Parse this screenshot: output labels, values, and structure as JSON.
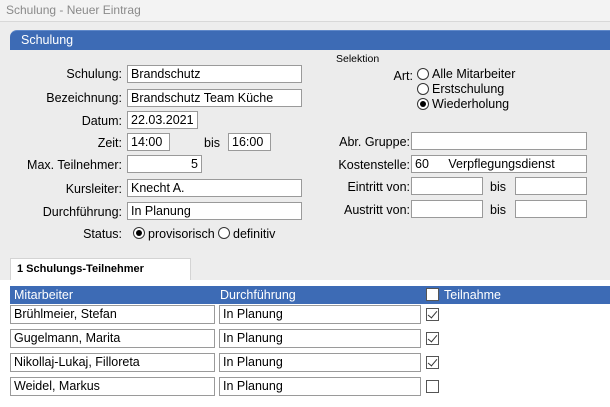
{
  "window": {
    "title": "Schulung - Neuer Eintrag"
  },
  "section": {
    "title": "Schulung"
  },
  "form": {
    "schulung_label": "Schulung:",
    "schulung_value": "Brandschutz",
    "bezeichnung_label": "Bezeichnung:",
    "bezeichnung_value": "Brandschutz Team Küche",
    "datum_label": "Datum:",
    "datum_value": "22.03.2021",
    "zeit_label": "Zeit:",
    "zeit_from": "14:00",
    "bis_label": "bis",
    "zeit_to": "16:00",
    "max_label": "Max. Teilnehmer:",
    "max_value": "5",
    "kursleiter_label": "Kursleiter:",
    "kursleiter_value": "Knecht A.",
    "durchfuehrung_label": "Durchführung:",
    "durchfuehrung_value": "In Planung",
    "status_label": "Status:",
    "status_options": [
      "provisorisch",
      "definitiv"
    ],
    "status_selected": "provisorisch"
  },
  "selektion": {
    "title": "Selektion",
    "art_label": "Art:",
    "art_options": [
      "Alle Mitarbeiter",
      "Erstschulung",
      "Wiederholung"
    ],
    "art_selected": "Wiederholung",
    "abr_gruppe_label": "Abr. Gruppe:",
    "abr_gruppe_value": "",
    "kostenstelle_label": "Kostenstelle:",
    "kostenstelle_code": "60",
    "kostenstelle_name": "Verpflegungsdienst",
    "eintritt_label": "Eintritt von:",
    "austritt_label": "Austritt von:",
    "bis_label": "bis"
  },
  "participants": {
    "tab_label": "1 Schulungs-Teilnehmer",
    "columns": [
      "Mitarbeiter",
      "Durchführung",
      "Teilnahme"
    ],
    "rows": [
      {
        "name": "Brühlmeier, Stefan",
        "status": "In Planung",
        "checked": true
      },
      {
        "name": "Gugelmann, Marita",
        "status": "In Planung",
        "checked": true
      },
      {
        "name": "Nikollaj-Lukaj, Filloreta",
        "status": "In Planung",
        "checked": true
      },
      {
        "name": "Weidel, Markus",
        "status": "In Planung",
        "checked": false
      }
    ]
  }
}
